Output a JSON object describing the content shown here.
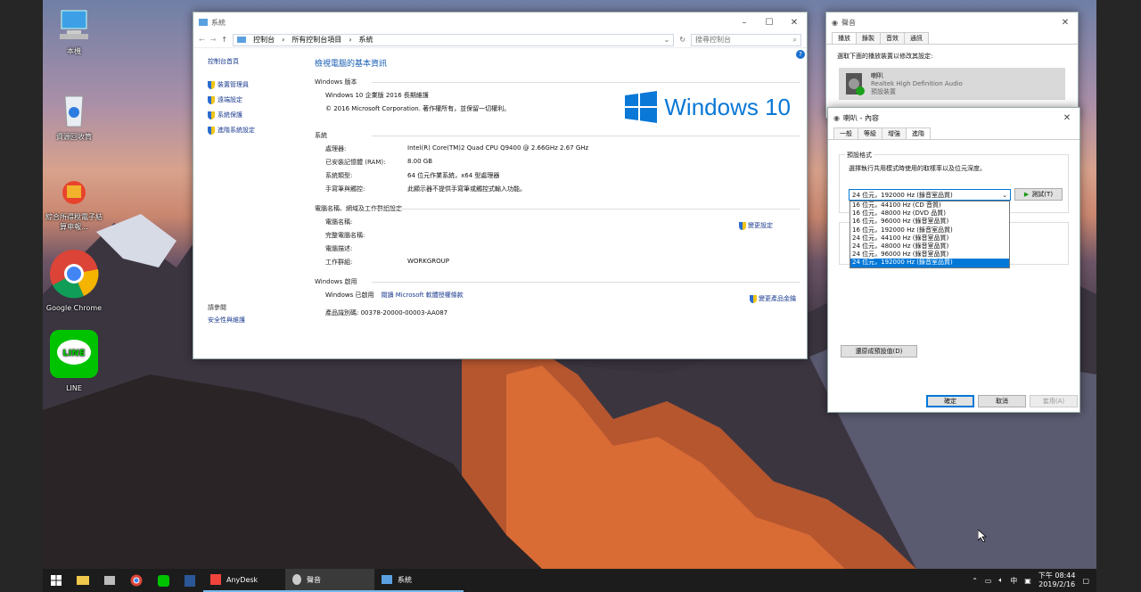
{
  "desktop": {
    "icons": [
      {
        "label": "本機"
      },
      {
        "label": "資源回收筒"
      },
      {
        "label": "綜合所得稅電子結算申報..."
      },
      {
        "label": "Google Chrome"
      },
      {
        "label": "LINE"
      }
    ]
  },
  "system_window": {
    "title": "系統",
    "breadcrumb": [
      "控制台",
      "所有控制台項目",
      "系統"
    ],
    "search_placeholder": "搜尋控制台",
    "left_nav": {
      "home": "控制台首頁",
      "items": [
        "裝置管理員",
        "遠端設定",
        "系統保護",
        "進階系統設定"
      ],
      "see_also": "請參閱",
      "see_also_link": "安全性與維護"
    },
    "heading": "檢視電腦的基本資訊",
    "edition_section": "Windows 版本",
    "edition": "Windows 10 企業版 2016 長期維護",
    "copyright": "© 2016 Microsoft Corporation. 著作權所有，並保留一切權利。",
    "logo_text": "Windows 10",
    "system_section": "系統",
    "system_rows": [
      {
        "k": "處理器:",
        "v": "Intel(R) Core(TM)2 Quad CPU    Q9400  @ 2.66GHz   2.67 GHz"
      },
      {
        "k": "已安裝記憶體 (RAM):",
        "v": "8.00 GB"
      },
      {
        "k": "系統類型:",
        "v": "64 位元作業系統，x64 型處理器"
      },
      {
        "k": "手寫筆與觸控:",
        "v": "此顯示器不提供手寫筆或觸控式輸入功能。"
      }
    ],
    "computer_section": "電腦名稱、網域及工作群組設定",
    "computer_rows": [
      {
        "k": "電腦名稱:",
        "v": ""
      },
      {
        "k": "完整電腦名稱:",
        "v": ""
      },
      {
        "k": "電腦描述:",
        "v": ""
      },
      {
        "k": "工作群組:",
        "v": "WORKGROUP"
      }
    ],
    "change_settings": "變更設定",
    "activation_section": "Windows 啟用",
    "activated": "Windows 已啟用",
    "license_link": "閱讀 Microsoft 軟體授權條款",
    "product_id": "產品識別碼: 00378-20000-00003-AA087",
    "change_key": "變更產品金鑰"
  },
  "sound_window": {
    "title": "聲音",
    "tabs": [
      "播放",
      "錄製",
      "音效",
      "通訊"
    ],
    "instruction": "選取下面的播放裝置以修改其設定:",
    "device_name": "喇叭",
    "device_driver": "Realtek High Definition Audio",
    "device_status": "預設裝置"
  },
  "props_window": {
    "title": "喇叭 - 內容",
    "tabs": [
      "一般",
      "等級",
      "增強",
      "進階"
    ],
    "group_label": "預設格式",
    "description": "選擇執行共用模式時使用的取樣率以及位元深度。",
    "selected": "24 位元，192000 Hz (錄音室品質)",
    "test_button": "測試(T)",
    "options": [
      "16 位元，44100 Hz (CD 音質)",
      "16 位元，48000 Hz (DVD 品質)",
      "16 位元，96000 Hz (錄音室品質)",
      "16 位元，192000 Hz (錄音室品質)",
      "24 位元，44100 Hz (錄音室品質)",
      "24 位元，48000 Hz (錄音室品質)",
      "24 位元，96000 Hz (錄音室品質)",
      "24 位元，192000 Hz (錄音室品質)"
    ],
    "restore_defaults": "還原成預設值(D)",
    "ok": "確定",
    "cancel": "取消",
    "apply": "套用(A)"
  },
  "taskbar": {
    "apps": [
      "AnyDesk",
      "聲音",
      "系統"
    ],
    "ime": "中",
    "time": "下午 08:44",
    "date": "2019/2/16"
  }
}
